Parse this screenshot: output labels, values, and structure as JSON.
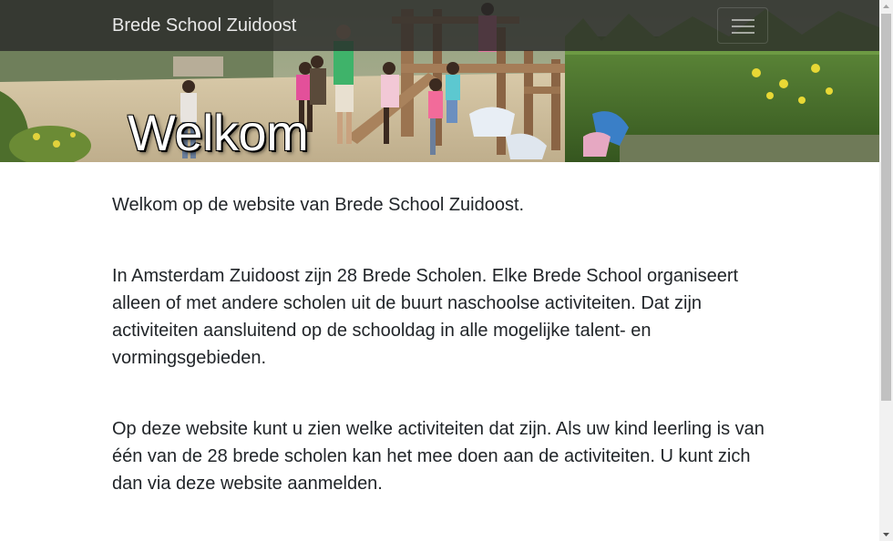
{
  "navbar": {
    "brand": "Brede School Zuidoost",
    "toggler_icon": "hamburger-icon"
  },
  "hero": {
    "title": "Welkom",
    "image": "children-playing-at-water-playground-photo"
  },
  "content": {
    "paragraphs": [
      "Welkom op de website van Brede School Zuidoost.",
      "In Amsterdam Zuidoost zijn 28 Brede Scholen. Elke Brede School organiseert alleen of met andere scholen uit de buurt naschoolse activiteiten. Dat zijn activiteiten aansluitend op de schooldag in alle mogelijke talent- en vormingsgebieden.",
      "Op deze website kunt u zien welke activiteiten dat zijn. Als uw kind leerling is van één van de 28 brede scholen kan het mee doen aan de activiteiten. U kunt zich dan via deze website aanmelden."
    ]
  },
  "colors": {
    "navbar_bg": "#282828",
    "text": "#212529",
    "brand_text": "#e9e9e9"
  }
}
